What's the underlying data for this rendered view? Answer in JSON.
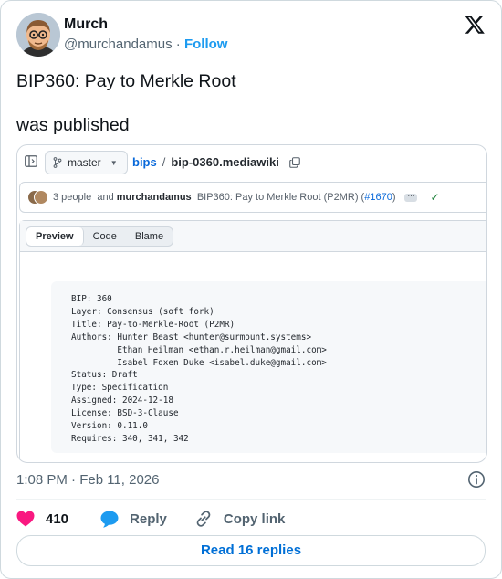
{
  "author": {
    "name": "Murch",
    "handle": "@murchandamus",
    "separator": "·",
    "follow_label": "Follow"
  },
  "tweet": {
    "line1": "BIP360: Pay to Merkle Root",
    "line2": "was published"
  },
  "screenshot": {
    "branch": "master",
    "repo": "bips",
    "path_separator": "/",
    "file": "bip-0360.mediawiki",
    "commit": {
      "people": "3 people",
      "and_label": "and",
      "author": "murchandamus",
      "message": "BIP360: Pay to Merkle Root (P2MR) (",
      "pr_link": "#1670",
      "message_end": ")"
    },
    "tabs": [
      "Preview",
      "Code",
      "Blame"
    ],
    "code_lines": [
      "BIP: 360",
      "Layer: Consensus (soft fork)",
      "Title: Pay-to-Merkle-Root (P2MR)",
      "Authors: Hunter Beast <hunter@surmount.systems>",
      "         Ethan Heilman <ethan.r.heilman@gmail.com>",
      "         Isabel Foxen Duke <isabel.duke@gmail.com>",
      "Status: Draft",
      "Type: Specification",
      "Assigned: 2024-12-18",
      "License: BSD-3-Clause",
      "Version: 0.11.0",
      "Requires: 340, 341, 342"
    ]
  },
  "footer": {
    "timestamp": "1:08 PM · Feb 11, 2026",
    "likes": "410",
    "reply_label": "Reply",
    "copy_link_label": "Copy link",
    "read_replies_label": "Read 16 replies"
  },
  "colors": {
    "accent": "#1d9bf0",
    "like": "#f91880",
    "link": "#0969da",
    "check": "#1a7f37"
  },
  "icons": [
    "x-logo-icon",
    "sidebar-panel-icon",
    "git-branch-icon",
    "copy-icon",
    "check-icon",
    "info-icon",
    "heart-icon",
    "reply-bubble-icon",
    "link-icon"
  ]
}
